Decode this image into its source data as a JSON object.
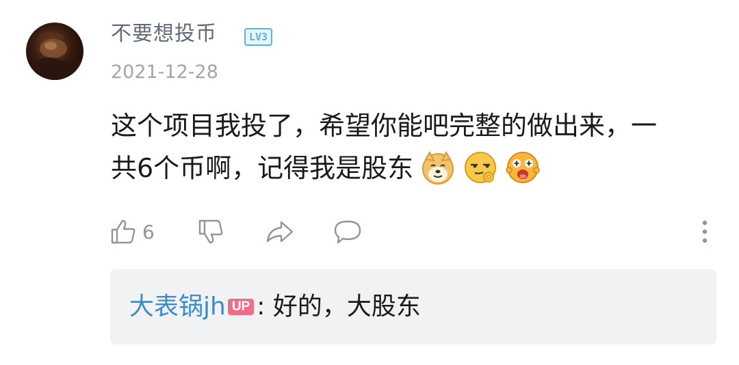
{
  "comment": {
    "username": "不要想投币",
    "level_badge": "LV3",
    "date": "2021-12-28",
    "text_line1": "这个项目我投了，希望你能吧完整的做出来，一",
    "text_line2": "共6个币啊，记得我是股东",
    "emojis": [
      "doge-emoji",
      "smirk-ok-emoji",
      "starry-eyed-emoji"
    ],
    "like_count": "6"
  },
  "reply": {
    "username": "大表锅jh",
    "badge": "UP",
    "separator": ": ",
    "text": "好的，大股东"
  },
  "colors": {
    "username": "#5f6b78",
    "level_badge": "#58b4e6",
    "date": "#a0a6ad",
    "action_icon": "#8e959c",
    "reply_user": "#3f8cc4",
    "up_badge": "#f06d8a",
    "reply_bg": "#f1f2f4"
  }
}
